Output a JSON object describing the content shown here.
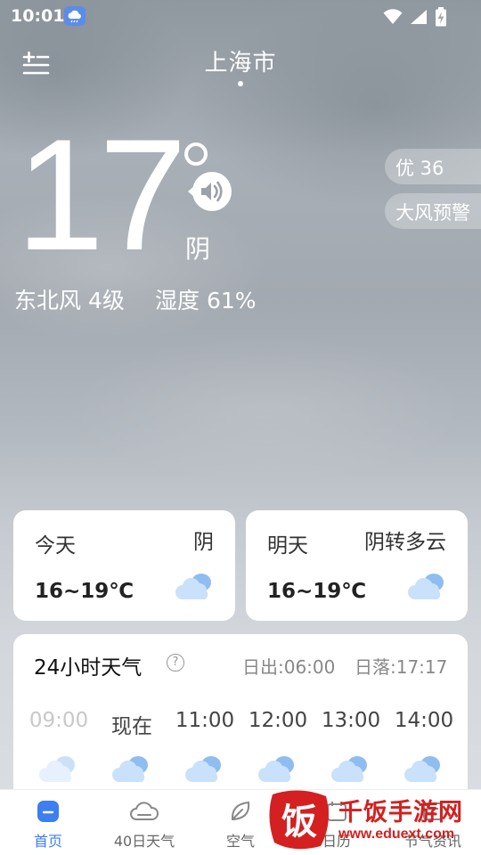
{
  "status_bar": {
    "time": "10:01"
  },
  "header": {
    "city": "上海市"
  },
  "current": {
    "temperature": "17",
    "condition": "阴",
    "wind": "东北风 4级",
    "humidity": "湿度 61%"
  },
  "badges": {
    "aqi": "优 36",
    "warning": "大风预警"
  },
  "daily": [
    {
      "label": "今天",
      "condition": "阴",
      "range": "16~19℃",
      "icon": "overcast-cloud-icon"
    },
    {
      "label": "明天",
      "condition": "阴转多云",
      "range": "16~19℃",
      "icon": "overcast-cloud-icon"
    }
  ],
  "hourly": {
    "title": "24小时天气",
    "sunrise": "日出:06:00",
    "sunset": "日落:17:17",
    "hours": [
      "09:00",
      "现在",
      "11:00",
      "12:00",
      "13:00",
      "14:00"
    ]
  },
  "nav": {
    "items": [
      {
        "label": "首页",
        "icon": "home-icon"
      },
      {
        "label": "40日天气",
        "icon": "cloud-outline-icon"
      },
      {
        "label": "空气",
        "icon": "leaf-icon"
      },
      {
        "label": "日历",
        "icon": "calendar-icon"
      },
      {
        "label": "节气资讯",
        "icon": "news-icon"
      }
    ]
  },
  "watermark": {
    "logo_char": "饭",
    "name": "千饭手游网",
    "url": "www.eduext.com"
  },
  "colors": {
    "accent": "#3d7ef0",
    "watermark_red": "#d42020"
  }
}
